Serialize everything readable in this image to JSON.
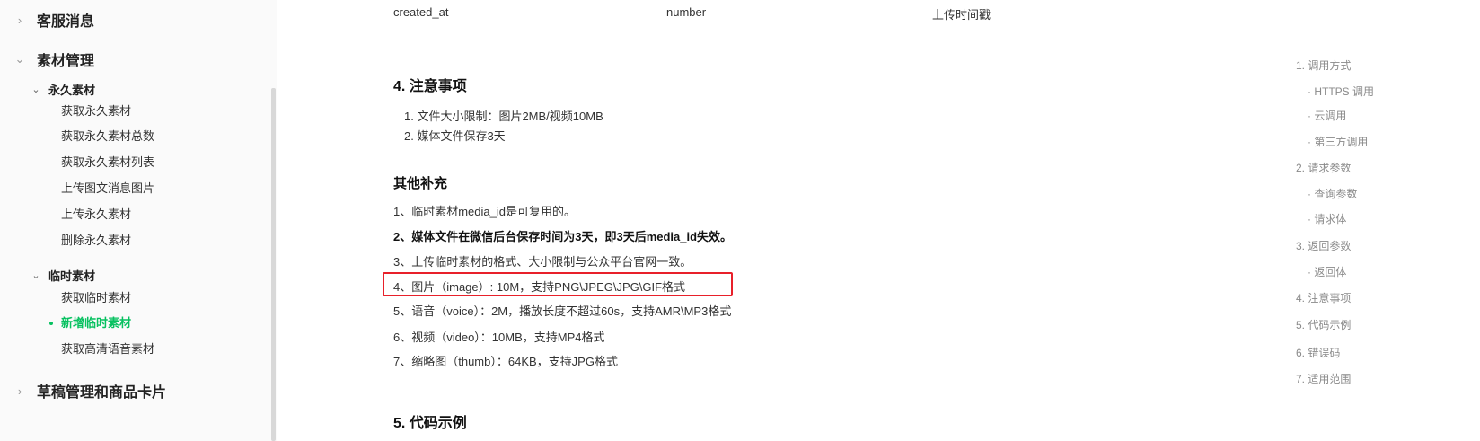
{
  "sidebar": {
    "top_category": {
      "label": "客服消息",
      "expanded": false
    },
    "material_category": {
      "label": "素材管理",
      "expanded": true
    },
    "permanent_group": {
      "label": "永久素材",
      "items": [
        "获取永久素材",
        "获取永久素材总数",
        "获取永久素材列表",
        "上传图文消息图片",
        "上传永久素材",
        "删除永久素材"
      ]
    },
    "temporary_group": {
      "label": "临时素材",
      "items": [
        "获取临时素材",
        "新增临时素材",
        "获取高清语音素材"
      ],
      "active_index": 1
    },
    "draft_category": {
      "label": "草稿管理和商品卡片",
      "expanded": false
    }
  },
  "table_row": {
    "name": "created_at",
    "type": "number",
    "desc": "上传时间戳"
  },
  "notes_section": {
    "title": "4. 注意事项",
    "items": [
      "1. 文件大小限制：图片2MB/视频10MB",
      "2. 媒体文件保存3天"
    ]
  },
  "supplement_section": {
    "title": "其他补充",
    "items": [
      "1、临时素材media_id是可复用的。",
      "2、媒体文件在微信后台保存时间为3天，即3天后media_id失效。",
      "3、上传临时素材的格式、大小限制与公众平台官网一致。",
      "4、图片（image）: 10M，支持PNG\\JPEG\\JPG\\GIF格式",
      "5、语音（voice）：2M，播放长度不超过60s，支持AMR\\MP3格式",
      "6、视频（video）：10MB，支持MP4格式",
      "7、缩略图（thumb）：64KB，支持JPG格式"
    ],
    "highlighted_index": 3
  },
  "next_section": {
    "title": "5. 代码示例"
  },
  "toc": {
    "items": [
      "1. 调用方式",
      "· HTTPS 调用",
      "· 云调用",
      "· 第三方调用",
      "2. 请求参数",
      "· 查询参数",
      "· 请求体",
      "3. 返回参数",
      "· 返回体",
      "4. 注意事项",
      "5. 代码示例",
      "6. 错误码",
      "7. 适用范围"
    ]
  },
  "colors": {
    "accent": "#07c160",
    "highlight_border": "#e8202a",
    "toc_text": "#8a8a8a"
  }
}
